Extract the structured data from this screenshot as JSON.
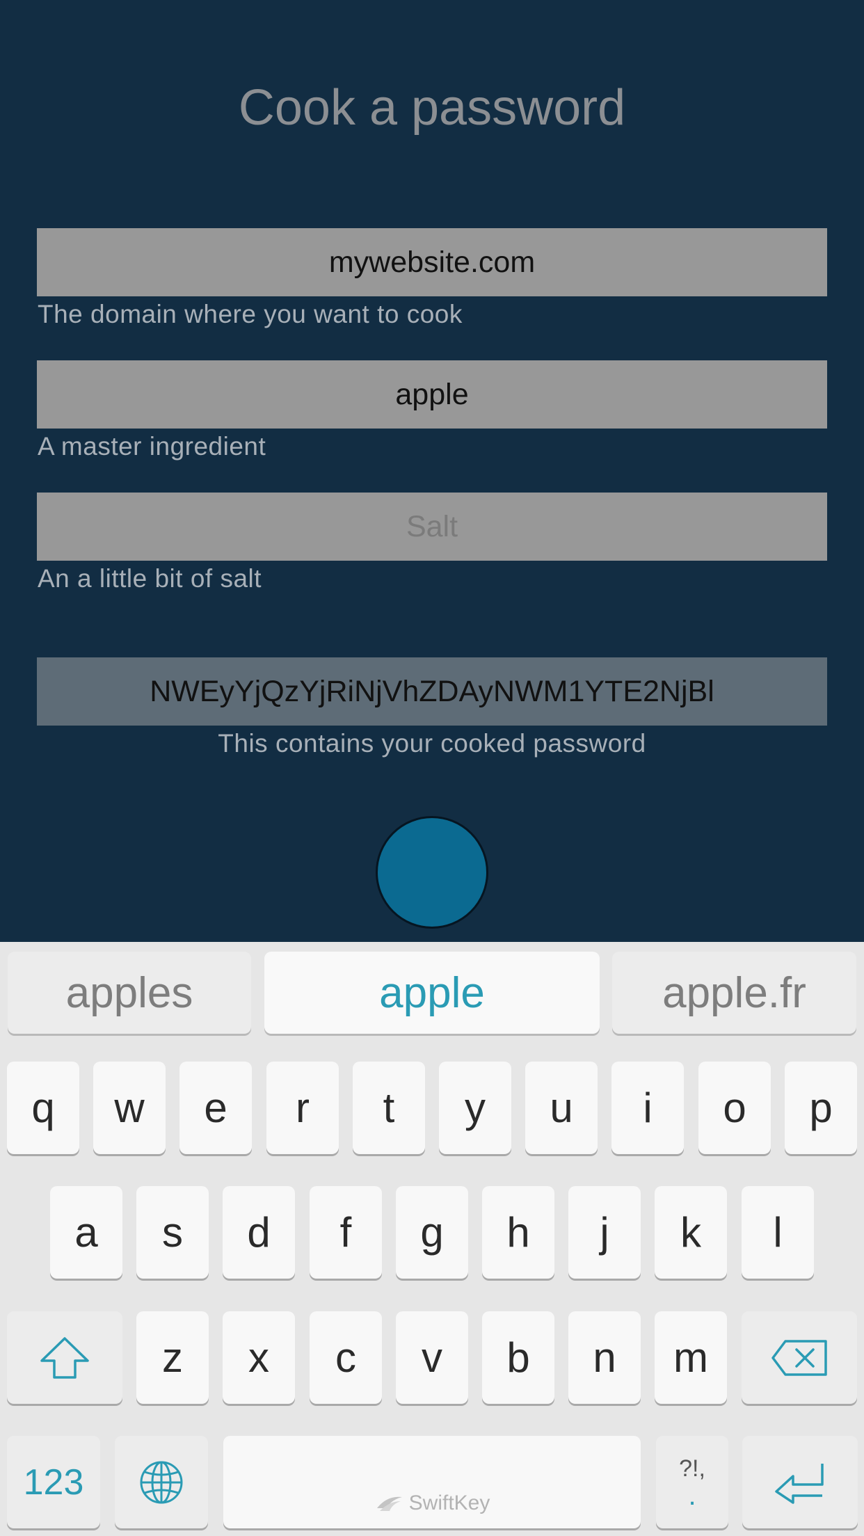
{
  "app": {
    "title": "Cook a password",
    "fields": {
      "domain": {
        "value": "mywebsite.com",
        "hint": "The domain where you want to cook"
      },
      "master": {
        "value": "apple",
        "hint": "A master ingredient"
      },
      "salt": {
        "value": "",
        "placeholder": "Salt",
        "hint": "An a little bit of salt"
      },
      "output": {
        "value": "NWEyYjQzYjRiNjVhZDAyNWM1YTE2NjBl",
        "hint": "This contains your cooked password"
      }
    },
    "accent_color": "#0b6a91",
    "background_color": "#122d43"
  },
  "keyboard": {
    "suggestions": [
      "apples",
      "apple",
      "apple.fr"
    ],
    "row1": [
      "q",
      "w",
      "e",
      "r",
      "t",
      "y",
      "u",
      "i",
      "o",
      "p"
    ],
    "row2": [
      "a",
      "s",
      "d",
      "f",
      "g",
      "h",
      "j",
      "k",
      "l"
    ],
    "row3": [
      "z",
      "x",
      "c",
      "v",
      "b",
      "n",
      "m"
    ],
    "numbers_label": "123",
    "space_brand": "SwiftKey",
    "punct_top": "?!,",
    "punct_bottom": ".",
    "accent_color": "#2a9bb4",
    "icons": {
      "shift": "shift-arrow-icon",
      "backspace": "backspace-icon",
      "globe": "globe-icon",
      "enter": "return-icon",
      "swiftkey": "swiftkey-logo-icon"
    }
  }
}
